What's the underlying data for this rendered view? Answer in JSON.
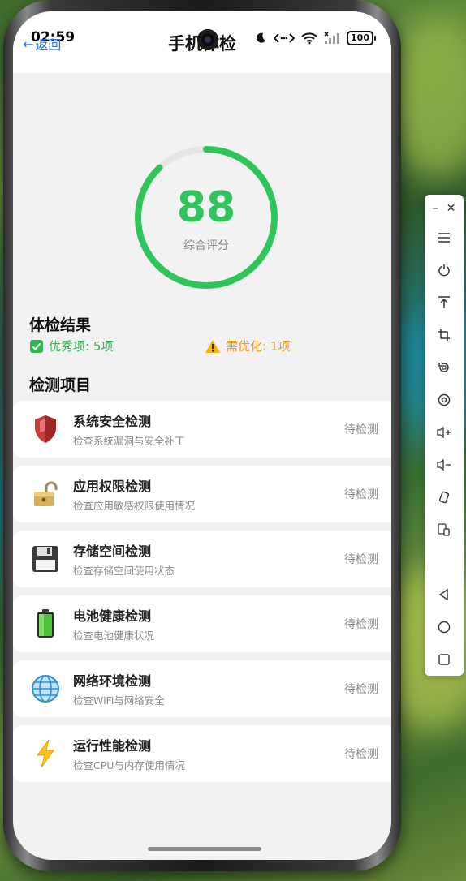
{
  "status_bar": {
    "time": "02:59",
    "battery": "100"
  },
  "header": {
    "back_label": "返回",
    "title": "手机体检"
  },
  "score": {
    "value": "88",
    "label": "综合评分",
    "progress": 0.88,
    "color": "#2fc55a"
  },
  "result": {
    "title": "体检结果",
    "good": "优秀项: 5项",
    "warn": "需优化: 1项"
  },
  "detection": {
    "title": "检测项目",
    "items": [
      {
        "name": "系统安全检测",
        "desc": "检查系统漏洞与安全补丁",
        "state": "待检测",
        "icon": "shield-icon"
      },
      {
        "name": "应用权限检测",
        "desc": "检查应用敏感权限使用情况",
        "state": "待检测",
        "icon": "lock-icon"
      },
      {
        "name": "存储空间检测",
        "desc": "检查存储空间使用状态",
        "state": "待检测",
        "icon": "floppy-disk-icon"
      },
      {
        "name": "电池健康检测",
        "desc": "检查电池健康状况",
        "state": "待检测",
        "icon": "battery-icon"
      },
      {
        "name": "网络环境检测",
        "desc": "检查WiFi与网络安全",
        "state": "待检测",
        "icon": "globe-icon"
      },
      {
        "name": "运行性能检测",
        "desc": "检查CPU与内存使用情况",
        "state": "待检测",
        "icon": "lightning-icon"
      }
    ]
  },
  "colors": {
    "accent_green": "#2fc55a",
    "warn_orange": "#f39a12",
    "link_blue": "#1f7ae0"
  }
}
